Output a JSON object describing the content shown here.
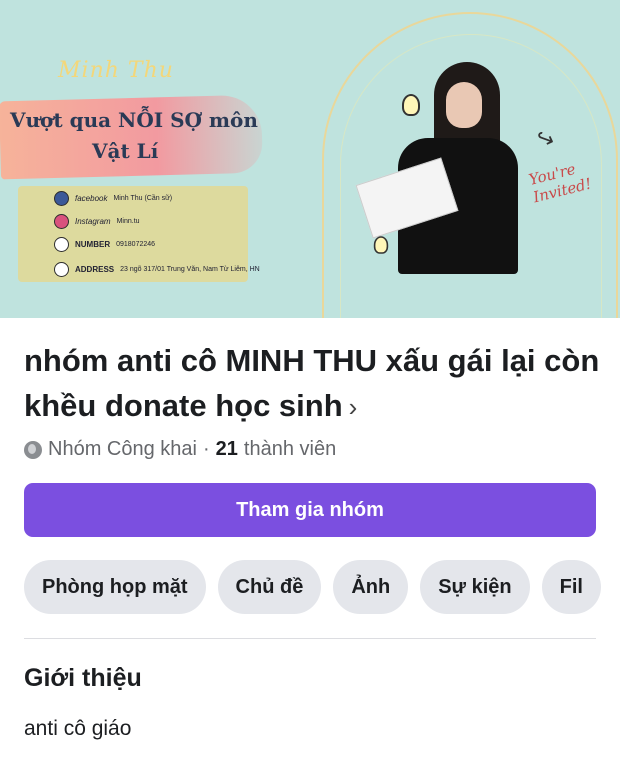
{
  "cover": {
    "script_name": "Minh Thu",
    "headline_line1": "Vượt qua NỖI SỢ môn",
    "headline_line2": "Vật Lí",
    "contacts": [
      {
        "icon": "facebook-icon",
        "label": "facebook",
        "value": "Minh Thu (Cần sữ)"
      },
      {
        "icon": "instagram-icon",
        "label": "Instagram",
        "value": "Minn.tu"
      },
      {
        "icon": "phone-icon",
        "label": "NUMBER",
        "value": "0918072246"
      },
      {
        "icon": "location-icon",
        "label": "ADDRESS",
        "value": "23 ngõ 317/01 Trung Văn, Nam Từ Liêm, HN"
      }
    ],
    "invited_text": "You're Invited!"
  },
  "group": {
    "title": "nhóm anti cô MINH THU xấu gái lại còn khều donate học sinh",
    "title_chevron": "›",
    "privacy": "Nhóm Công khai",
    "separator": "·",
    "member_count": "21",
    "member_label": "thành viên"
  },
  "join_button": "Tham gia nhóm",
  "tabs": [
    "Phòng họp mặt",
    "Chủ đề",
    "Ảnh",
    "Sự kiện",
    "Fil"
  ],
  "about": {
    "heading": "Giới thiệu",
    "description": "anti cô giáo"
  }
}
